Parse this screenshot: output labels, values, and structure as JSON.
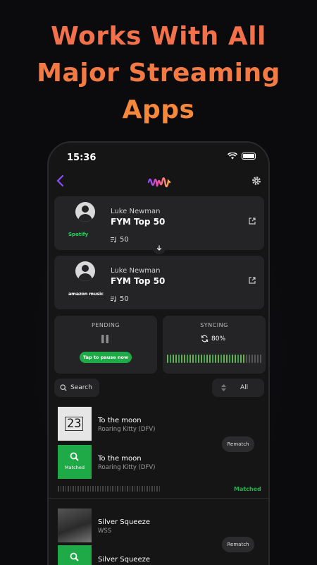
{
  "headline": {
    "line1": "Works With All",
    "line2": "Major Streaming",
    "line3": "Apps"
  },
  "status": {
    "time": "15:36"
  },
  "icons": {
    "back": "chevron-left-icon",
    "logo": "waveform-logo",
    "settings": "gear-icon",
    "external": "external-link-icon"
  },
  "colors": {
    "accent": "#1faa48",
    "headline": "#f2704a",
    "purple": "#7b4cff"
  },
  "playlists": [
    {
      "owner": "Luke Newman",
      "name": "FYM Top 50",
      "count": "50",
      "service": "Spotify"
    },
    {
      "owner": "Luke Newman",
      "name": "FYM Top 50",
      "count": "50",
      "service": "amazon music"
    }
  ],
  "pending": {
    "title": "PENDING",
    "button": "Tap to pause now"
  },
  "syncing": {
    "title": "SYNCING",
    "progress": "80%"
  },
  "search": {
    "label": "Search"
  },
  "filter": {
    "label": "All"
  },
  "tracks": [
    {
      "source": {
        "title": "To the moon",
        "artist": "Roaring Kitty (DFV)",
        "art_text": "23"
      },
      "match": {
        "title": "To the moon",
        "artist": "Roaring Kitty (DFV)",
        "label": "Matched"
      },
      "rematch": "Rematch",
      "status": "Matched"
    },
    {
      "source": {
        "title": "Silver Squeeze",
        "artist": "WSS"
      },
      "match": {
        "title": "Silver Squeeze"
      },
      "rematch": "Rematch"
    }
  ]
}
